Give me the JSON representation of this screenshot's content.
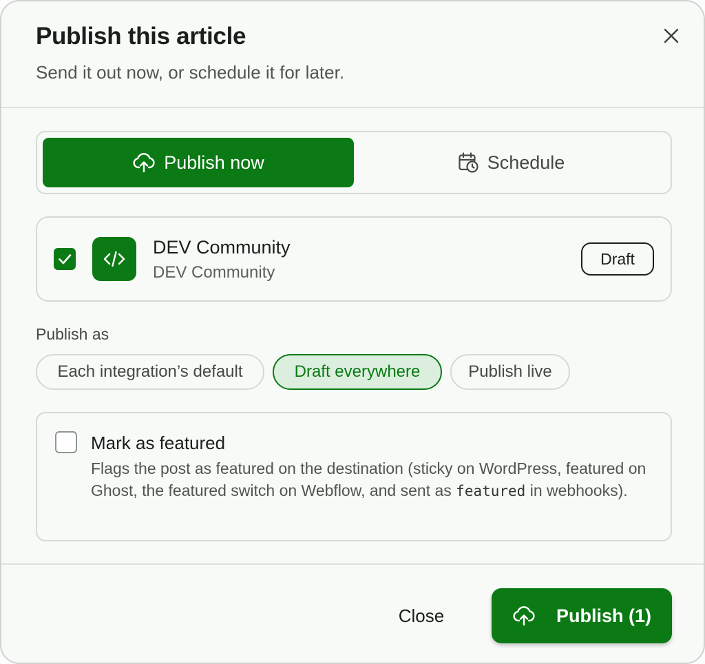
{
  "dialog": {
    "title": "Publish this article",
    "subtitle": "Send it out now, or schedule it for later."
  },
  "mode_toggle": {
    "publish_now_label": "Publish now",
    "schedule_label": "Schedule",
    "selected": "Publish now"
  },
  "integration": {
    "checked": true,
    "name": "DEV Community",
    "subtitle": "DEV Community",
    "badge": "Draft",
    "icon": "code-icon"
  },
  "publish_as": {
    "label": "Publish as",
    "options": [
      "Each integration’s default",
      "Draft everywhere",
      "Publish live"
    ],
    "selected": "Draft everywhere"
  },
  "featured": {
    "checked": false,
    "title": "Mark as featured",
    "desc_before": "Flags the post as featured on the destination (sticky on WordPress, featured on Ghost, the featured switch on Webflow, and sent as ",
    "desc_code": "featured",
    "desc_after": " in webhooks)."
  },
  "footer": {
    "close_label": "Close",
    "publish_label": "Publish (1)"
  },
  "colors": {
    "accent": "#0b7a14",
    "chip_selected_bg": "#dcefdf",
    "border": "#d5dad6"
  }
}
